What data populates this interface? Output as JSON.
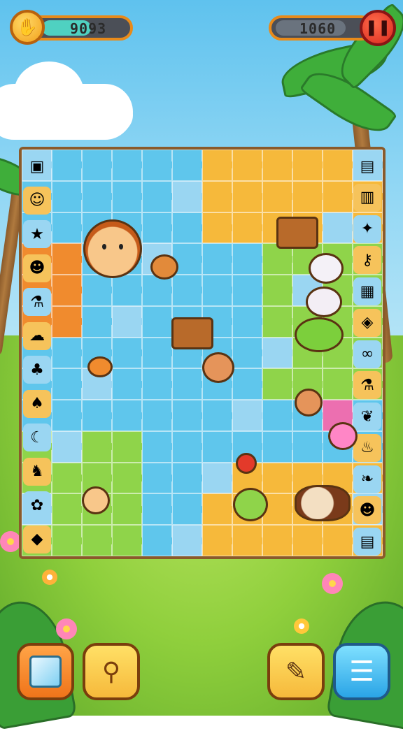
{
  "hud": {
    "coins_value": "9093",
    "coins_icon": "coin-hand-icon",
    "score_value": "1060",
    "pause_icon": "pause-icon"
  },
  "board": {
    "tile_colors": [
      "#5fc6ec",
      "#f6b93b",
      "#8fd44a",
      "#f08b2e",
      "#ec6fb0",
      "#9ad6f2"
    ],
    "left_column_icons": [
      "sugar-cube-icon",
      "monkey-icon",
      "star-icon",
      "pirate-icon",
      "bottle-icon",
      "ghost-icon",
      "palm-tree-icon",
      "pear-icon",
      "banana-icon",
      "horse-icon",
      "pineapple-icon",
      "ice-cube-icon"
    ],
    "right_column_icons": [
      "book-stack-icon",
      "jar-icon",
      "fairy-icon",
      "key-icon",
      "chest-item-icon",
      "gem-icon",
      "chain-icon",
      "bottle-icon",
      "pretzel-icon",
      "cake-icon",
      "leaf-icon",
      "pig-icon",
      "book-stack-icon"
    ]
  },
  "toolbar": {
    "cube_button_icon": "cube-icon",
    "hint_button_icon": "magnifier-hint-icon",
    "pin_button_icon": "pin-icon",
    "menu_button_icon": "menu-icon"
  }
}
